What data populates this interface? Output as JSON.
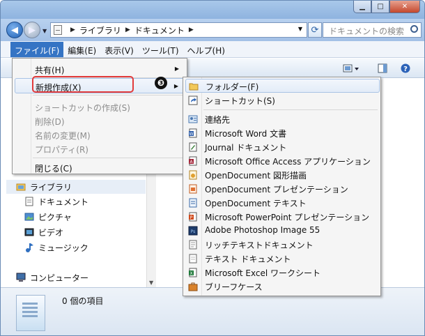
{
  "address": {
    "crumbs": [
      "ライブラリ",
      "ドキュメント"
    ],
    "search_placeholder": "ドキュメントの検索"
  },
  "menubar": {
    "items": [
      "ファイル(F)",
      "編集(E)",
      "表示(V)",
      "ツール(T)",
      "ヘルプ(H)"
    ]
  },
  "file_menu": {
    "items": [
      {
        "label": "共有(H)",
        "enabled": true,
        "submenu": true
      },
      {
        "label": "新規作成(X)",
        "enabled": true,
        "submenu": true
      },
      {
        "label": "ショートカットの作成(S)",
        "enabled": false
      },
      {
        "label": "削除(D)",
        "enabled": false
      },
      {
        "label": "名前の変更(M)",
        "enabled": false
      },
      {
        "label": "プロパティ(R)",
        "enabled": false
      },
      {
        "label": "閉じる(C)",
        "enabled": true
      }
    ]
  },
  "callout": {
    "number": "❸"
  },
  "new_submenu": {
    "items": [
      {
        "label": "フォルダー(F)",
        "icon": "folder-icon"
      },
      {
        "label": "ショートカット(S)",
        "icon": "shortcut-icon"
      },
      {
        "label": "連絡先",
        "icon": "contact-icon"
      },
      {
        "label": "Microsoft Word 文書",
        "icon": "word-icon"
      },
      {
        "label": "Journal ドキュメント",
        "icon": "journal-icon"
      },
      {
        "label": "Microsoft Office Access アプリケーション",
        "icon": "access-icon"
      },
      {
        "label": "OpenDocument 図形描画",
        "icon": "odg-icon"
      },
      {
        "label": "OpenDocument プレゼンテーション",
        "icon": "odp-icon"
      },
      {
        "label": "OpenDocument テキスト",
        "icon": "odt-icon"
      },
      {
        "label": "Microsoft PowerPoint プレゼンテーション",
        "icon": "powerpoint-icon"
      },
      {
        "label": "Adobe Photoshop Image 55",
        "icon": "photoshop-icon"
      },
      {
        "label": "リッチテキストドキュメント",
        "icon": "rtf-icon"
      },
      {
        "label": "テキスト ドキュメント",
        "icon": "text-icon"
      },
      {
        "label": "Microsoft Excel ワークシート",
        "icon": "excel-icon"
      },
      {
        "label": "ブリーフケース",
        "icon": "briefcase-icon"
      }
    ]
  },
  "nav_pane": {
    "library_label": "ライブラリ",
    "items": [
      "ドキュメント",
      "ピクチャ",
      "ビデオ",
      "ミュージック"
    ],
    "computer_label": "コンピューター"
  },
  "status": {
    "text": "0 個の項目"
  },
  "colors": {
    "menu_active": "#3574c4",
    "highlight_box": "#e23b3b"
  }
}
